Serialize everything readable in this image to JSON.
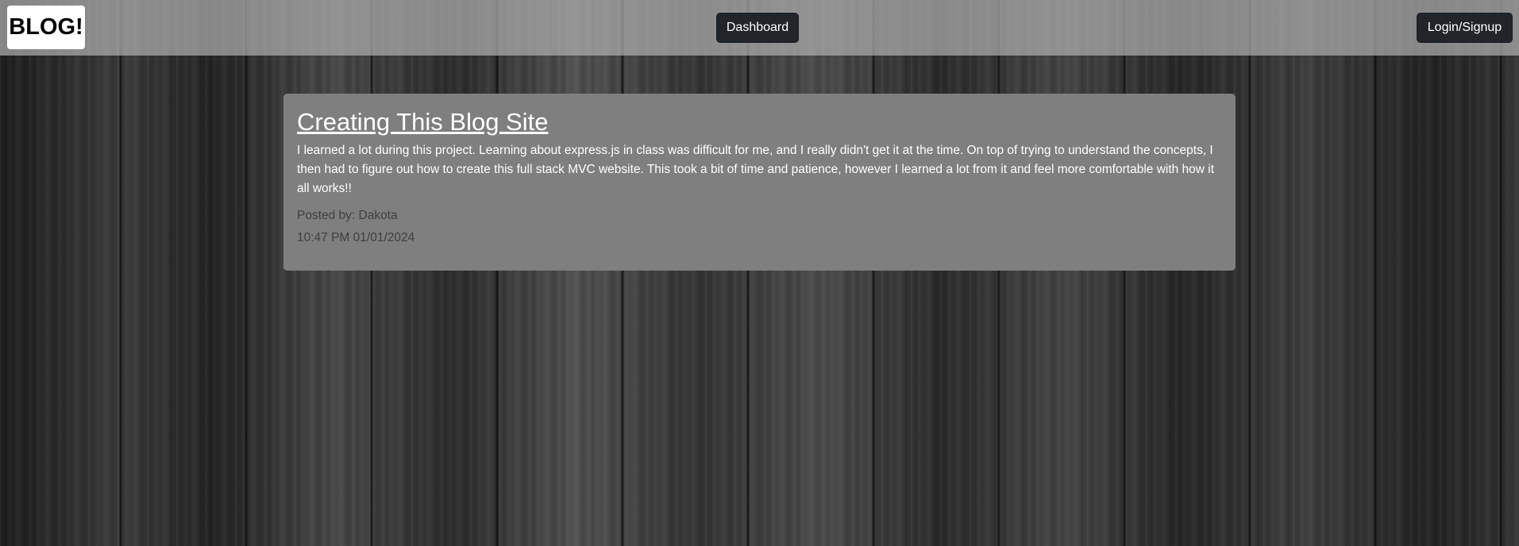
{
  "header": {
    "brand": "BLOG!",
    "dashboard_label": "Dashboard",
    "login_label": "Login/Signup"
  },
  "posts": [
    {
      "title": "Creating This Blog Site",
      "body": "I learned a lot during this project. Learning about express.js in class was difficult for me, and I really didn't get it at the time. On top of trying to understand the concepts, I then had to figure out how to create this full stack MVC website. This took a bit of time and patience, however I learned a lot from it and feel more comfortable with how it all works!!",
      "author_line": "Posted by: Dakota",
      "timestamp": "10:47 PM 01/01/2024"
    }
  ],
  "colors": {
    "navbar_bg": "#afafaf",
    "button_bg": "#212529",
    "card_bg": "#7f7f7f",
    "meta_text": "#3f3f3f"
  }
}
